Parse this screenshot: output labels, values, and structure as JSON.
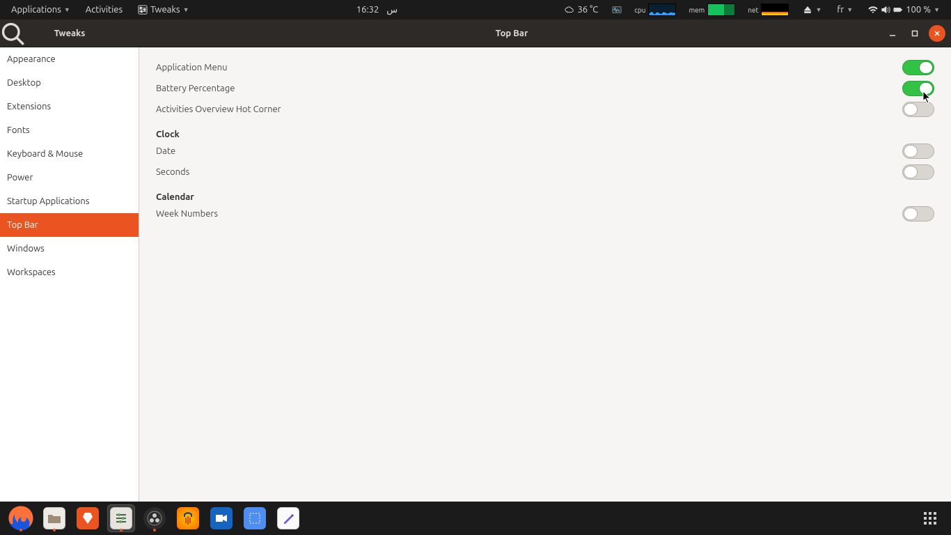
{
  "panel": {
    "applications": "Applications",
    "activities": "Activities",
    "active_app": "Tweaks",
    "clock": "16:32",
    "clock_locale": "س",
    "weather": "36 °C",
    "cpu_label": "cpu",
    "mem_label": "mem",
    "net_label": "net",
    "lang": "fr",
    "battery": "100 %"
  },
  "window": {
    "app_title": "Tweaks",
    "page_title": "Top Bar"
  },
  "sidebar": {
    "items": [
      {
        "label": "Appearance"
      },
      {
        "label": "Desktop"
      },
      {
        "label": "Extensions"
      },
      {
        "label": "Fonts"
      },
      {
        "label": "Keyboard & Mouse"
      },
      {
        "label": "Power"
      },
      {
        "label": "Startup Applications"
      },
      {
        "label": "Top Bar"
      },
      {
        "label": "Windows"
      },
      {
        "label": "Workspaces"
      }
    ],
    "active_index": 7
  },
  "content": {
    "rows": [
      {
        "label": "Application Menu",
        "on": true
      },
      {
        "label": "Battery Percentage",
        "on": true
      },
      {
        "label": "Activities Overview Hot Corner",
        "on": false
      }
    ],
    "section_clock": "Clock",
    "rows_clock": [
      {
        "label": "Date",
        "on": false
      },
      {
        "label": "Seconds",
        "on": false
      }
    ],
    "section_calendar": "Calendar",
    "rows_calendar": [
      {
        "label": "Week Numbers",
        "on": false
      }
    ]
  },
  "dock": {
    "items": [
      {
        "name": "firefox",
        "running": true
      },
      {
        "name": "files",
        "running": true
      },
      {
        "name": "software",
        "running": false
      },
      {
        "name": "tweaks",
        "running": true,
        "active": true
      },
      {
        "name": "obs",
        "running": true
      },
      {
        "name": "audacity",
        "running": false
      },
      {
        "name": "kdenlive",
        "running": false
      },
      {
        "name": "screenshot",
        "running": false
      },
      {
        "name": "text-editor",
        "running": false
      }
    ]
  },
  "colors": {
    "accent": "#e95420",
    "toggle_on": "#33c146"
  }
}
